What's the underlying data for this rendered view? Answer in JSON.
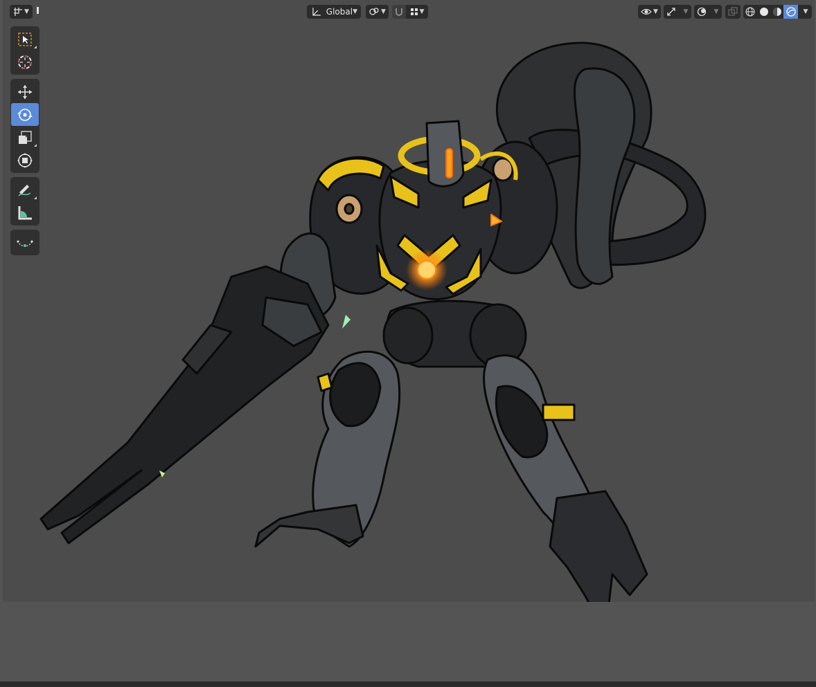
{
  "header": {
    "transform_orientation": "Global"
  },
  "toolbar": {
    "tools": [
      {
        "name": "select-box",
        "active": false
      },
      {
        "name": "cursor",
        "active": false
      },
      {
        "name": "move",
        "active": false
      },
      {
        "name": "rotate",
        "active": true
      },
      {
        "name": "scale",
        "active": false
      },
      {
        "name": "transform",
        "active": false
      },
      {
        "name": "annotate",
        "active": false
      },
      {
        "name": "measure",
        "active": false
      },
      {
        "name": "curve",
        "active": false
      }
    ]
  },
  "colors": {
    "viewport_bg": "#4c4c4c",
    "accent_active": "#5a8ad8",
    "robot_yellow": "#e8c21a",
    "robot_glow": "#ff8a1a"
  }
}
